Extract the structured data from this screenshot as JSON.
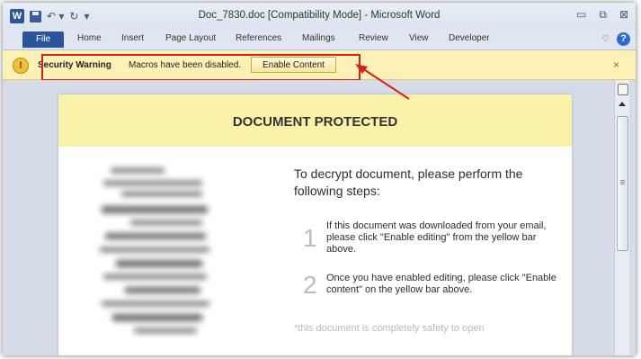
{
  "window": {
    "title": "Doc_7830.doc [Compatibility Mode] - Microsoft Word",
    "quick_access": {
      "app_icon": "W",
      "undo_glyph": "↶ ▾",
      "redo_glyph": "↻",
      "customize_glyph": "▾"
    },
    "controls": {
      "minimize": "▭",
      "restore": "⧉",
      "close": "⊠"
    }
  },
  "ribbon": {
    "tabs": [
      "File",
      "Home",
      "Insert",
      "Page Layout",
      "References",
      "Mailings",
      "Review",
      "View",
      "Developer"
    ],
    "help_glyph": "?",
    "minimize_glyph": "♡"
  },
  "message_bar": {
    "icon_glyph": "!",
    "title": "Security Warning",
    "message": "Macros have been disabled.",
    "button_label": "Enable Content",
    "close_glyph": "×"
  },
  "document": {
    "banner_title": "DOCUMENT PROTECTED",
    "heading": "To decrypt document, please perform the following steps:",
    "steps": [
      {
        "number": "1",
        "text": "If this document was downloaded from your email, please click \"Enable editing\" from the yellow bar above."
      },
      {
        "number": "2",
        "text": "Once you have enabled editing, please click \"Enable content\" on the yellow bar above."
      }
    ],
    "note": "*this document is completely safety to open"
  },
  "colors": {
    "message_bar": "#fdf1b5",
    "banner": "#fbf2a9",
    "annotation": "#d62020",
    "file_tab": "#2a5699"
  }
}
